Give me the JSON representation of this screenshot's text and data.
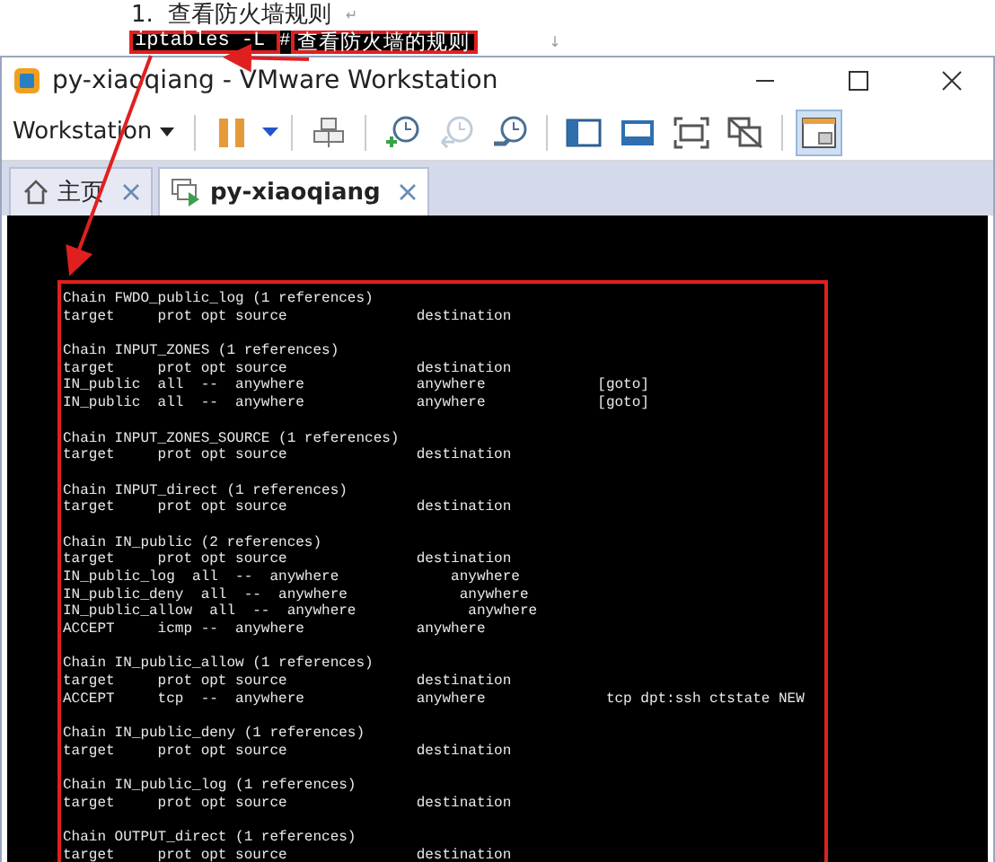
{
  "document": {
    "step_number": "1.",
    "heading": "查看防火墙规则",
    "heading_mark": "↵",
    "command": "iptables -L",
    "comment_hash": "#",
    "comment": "查看防火墙的规则",
    "line_mark": "↓"
  },
  "window": {
    "title": "py-xiaoqiang - VMware Workstation"
  },
  "toolbar": {
    "menu": "Workstation",
    "buttons": [
      {
        "kind": "pause",
        "disabled": false,
        "selected": false
      },
      {
        "kind": "devices",
        "disabled": false,
        "selected": false
      },
      {
        "kind": "snapshot",
        "disabled": false,
        "selected": false
      },
      {
        "kind": "revert",
        "disabled": true,
        "selected": false
      },
      {
        "kind": "manager",
        "disabled": false,
        "selected": false
      },
      {
        "kind": "sidebar",
        "disabled": false,
        "selected": false
      },
      {
        "kind": "console",
        "disabled": false,
        "selected": false
      },
      {
        "kind": "fullscreen",
        "disabled": false,
        "selected": false
      },
      {
        "kind": "unity",
        "disabled": false,
        "selected": false
      },
      {
        "kind": "library",
        "disabled": false,
        "selected": true
      }
    ]
  },
  "tabs": [
    {
      "kind": "home",
      "label": "主页",
      "selected": false
    },
    {
      "kind": "vm",
      "label": "py-xiaoqiang",
      "selected": true
    }
  ],
  "terminal": {
    "blocks": [
      [
        "Chain FWDO_public_log (1 references)",
        "target     prot opt source               destination"
      ],
      [
        "Chain INPUT_ZONES (1 references)",
        "target     prot opt source               destination",
        "IN_public  all  --  anywhere             anywhere             [goto]",
        "IN_public  all  --  anywhere             anywhere             [goto]"
      ],
      [
        "Chain INPUT_ZONES_SOURCE (1 references)",
        "target     prot opt source               destination"
      ],
      [
        "Chain INPUT_direct (1 references)",
        "target     prot opt source               destination"
      ],
      [
        "Chain IN_public (2 references)",
        "target     prot opt source               destination",
        "IN_public_log  all  --  anywhere             anywhere",
        "IN_public_deny  all  --  anywhere             anywhere",
        "IN_public_allow  all  --  anywhere             anywhere",
        "ACCEPT     icmp --  anywhere             anywhere"
      ],
      [
        "Chain IN_public_allow (1 references)",
        "target     prot opt source               destination",
        "ACCEPT     tcp  --  anywhere             anywhere              tcp dpt:ssh ctstate NEW"
      ],
      [
        "Chain IN_public_deny (1 references)",
        "target     prot opt source               destination"
      ],
      [
        "Chain IN_public_log (1 references)",
        "target     prot opt source               destination"
      ],
      [
        "Chain OUTPUT_direct (1 references)",
        "target     prot opt source               destination"
      ]
    ]
  }
}
